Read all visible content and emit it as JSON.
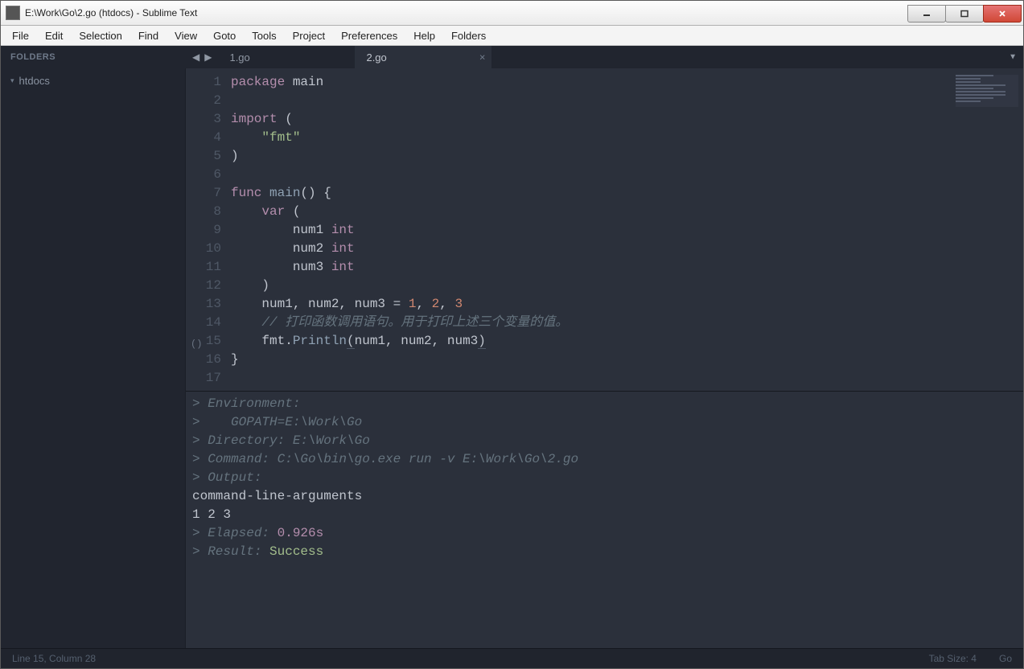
{
  "window": {
    "title": "E:\\Work\\Go\\2.go (htdocs) - Sublime Text"
  },
  "menu": [
    "File",
    "Edit",
    "Selection",
    "Find",
    "View",
    "Goto",
    "Tools",
    "Project",
    "Preferences",
    "Help",
    "Folders"
  ],
  "sidebar": {
    "header": "FOLDERS",
    "root": "htdocs"
  },
  "tabs": [
    {
      "label": "1.go",
      "active": false
    },
    {
      "label": "2.go",
      "active": true
    }
  ],
  "gutter_mark_line": 15,
  "gutter_mark_text": "()",
  "code_lines": [
    [
      {
        "t": "package ",
        "c": "kw"
      },
      {
        "t": "main",
        "c": "pkg"
      }
    ],
    [],
    [
      {
        "t": "import ",
        "c": "kw"
      },
      {
        "t": "(",
        "c": "pn"
      }
    ],
    [
      {
        "t": "    ",
        "c": "pn"
      },
      {
        "t": "\"fmt\"",
        "c": "str"
      }
    ],
    [
      {
        "t": ")",
        "c": "pn"
      }
    ],
    [],
    [
      {
        "t": "func ",
        "c": "kw"
      },
      {
        "t": "main",
        "c": "fn"
      },
      {
        "t": "() {",
        "c": "pn"
      }
    ],
    [
      {
        "t": "    ",
        "c": "pn"
      },
      {
        "t": "var ",
        "c": "kw"
      },
      {
        "t": "(",
        "c": "pn"
      }
    ],
    [
      {
        "t": "        num1 ",
        "c": "id"
      },
      {
        "t": "int",
        "c": "kw"
      }
    ],
    [
      {
        "t": "        num2 ",
        "c": "id"
      },
      {
        "t": "int",
        "c": "kw"
      }
    ],
    [
      {
        "t": "        num3 ",
        "c": "id"
      },
      {
        "t": "int",
        "c": "kw"
      }
    ],
    [
      {
        "t": "    )",
        "c": "pn"
      }
    ],
    [
      {
        "t": "    num1, num2, num3 = ",
        "c": "id"
      },
      {
        "t": "1",
        "c": "num"
      },
      {
        "t": ", ",
        "c": "pn"
      },
      {
        "t": "2",
        "c": "num"
      },
      {
        "t": ", ",
        "c": "pn"
      },
      {
        "t": "3",
        "c": "num"
      }
    ],
    [
      {
        "t": "    // 打印函数调用语句。用于打印上述三个变量的值。",
        "c": "cm"
      }
    ],
    [
      {
        "t": "    fmt.",
        "c": "id"
      },
      {
        "t": "Println",
        "c": "fn"
      },
      {
        "t": "(",
        "c": "pn ul"
      },
      {
        "t": "num1, num2, num3",
        "c": "id"
      },
      {
        "t": ")",
        "c": "pn ul"
      }
    ],
    [
      {
        "t": "}",
        "c": "pn"
      }
    ],
    []
  ],
  "output_lines": [
    [
      {
        "t": "> ",
        "c": "out-prompt"
      },
      {
        "t": "Environment:",
        "c": "out-dim"
      }
    ],
    [
      {
        "t": "> ",
        "c": "out-prompt"
      },
      {
        "t": "   GOPATH=E:\\Work\\Go",
        "c": "out-dim"
      }
    ],
    [
      {
        "t": "> ",
        "c": "out-prompt"
      },
      {
        "t": "Directory: E:\\Work\\Go",
        "c": "out-dim"
      }
    ],
    [
      {
        "t": "> ",
        "c": "out-prompt"
      },
      {
        "t": "Command: C:\\Go\\bin\\go.exe run -v E:\\Work\\Go\\2.go",
        "c": "out-dim"
      }
    ],
    [
      {
        "t": "> ",
        "c": "out-prompt"
      },
      {
        "t": "Output:",
        "c": "out-dim"
      }
    ],
    [
      {
        "t": "command-line-arguments",
        "c": "out-plain"
      }
    ],
    [
      {
        "t": "1 2 3",
        "c": "out-plain"
      }
    ],
    [
      {
        "t": "> ",
        "c": "out-prompt"
      },
      {
        "t": "Elapsed: ",
        "c": "out-dim"
      },
      {
        "t": "0.926s",
        "c": "out-time"
      }
    ],
    [
      {
        "t": "> ",
        "c": "out-prompt"
      },
      {
        "t": "Result: ",
        "c": "out-dim"
      },
      {
        "t": "Success",
        "c": "out-ok"
      }
    ]
  ],
  "status": {
    "left": "Line 15, Column 28",
    "tab_size": "Tab Size: 4",
    "syntax": "Go"
  }
}
